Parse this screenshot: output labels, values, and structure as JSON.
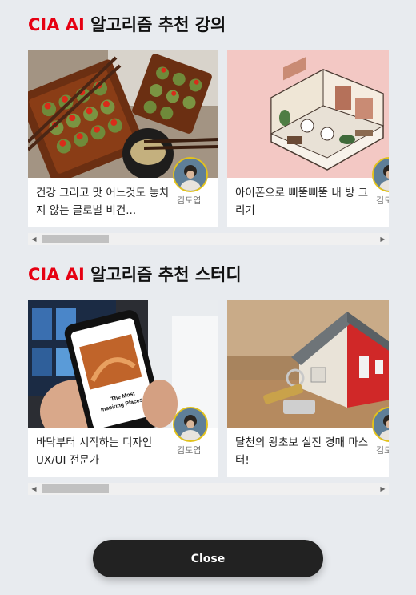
{
  "lectures": {
    "title_brand": "CIA AI",
    "title_rest": " 알고리즘 추천 강의",
    "cards": [
      {
        "title": "건강 그리고 맛 어느것도 놓치지 않는 글로벌 비건...",
        "author": "김도엽",
        "image": "food-photo"
      },
      {
        "title": "아이폰으로 삐뚤삐뚤 내 방 그리기",
        "author": "김도엽",
        "image": "room-illustration"
      }
    ]
  },
  "studies": {
    "title_brand": "CIA AI",
    "title_rest": " 알고리즘 추천 스터디",
    "cards": [
      {
        "title": "바닥부터 시작하는 디자인 UX/UI 전문가",
        "author": "김도엽",
        "image": "phone-photo"
      },
      {
        "title": "달천의 왕초보 실전 경매 마스터!",
        "author": "김도엽",
        "image": "house-key-photo"
      }
    ]
  },
  "phone_screen": {
    "line1": "The Most",
    "line2": "Inspiring Places"
  },
  "close_label": "Close",
  "colors": {
    "brand": "#e60012",
    "background": "#e8ebef",
    "button": "#222222",
    "avatar_ring": "#e2c21c"
  }
}
